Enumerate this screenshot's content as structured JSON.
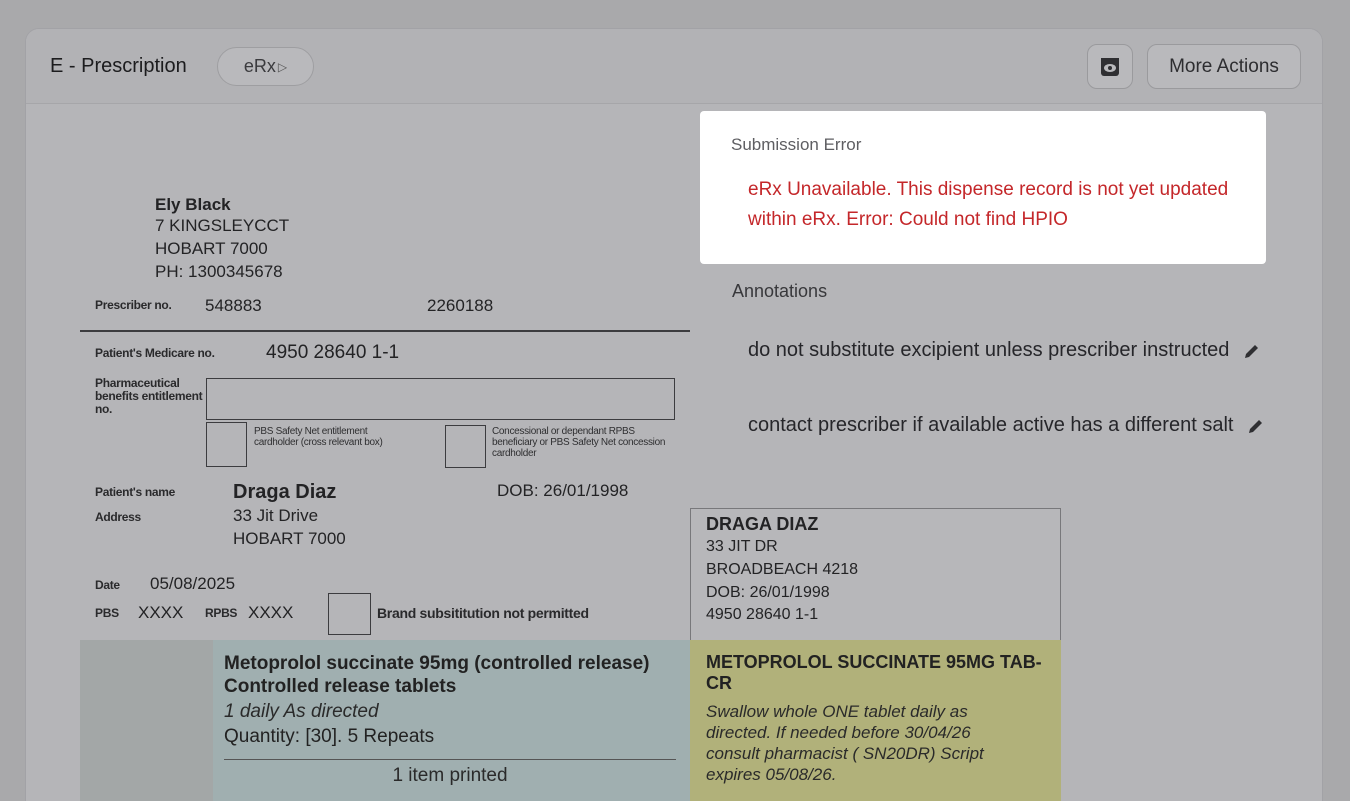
{
  "header": {
    "title": "E - Prescription",
    "badge": "eRx",
    "badge_icon": "arrow-icon",
    "preview_icon": "eye-icon",
    "more_actions": "More Actions"
  },
  "prescriber": {
    "name": "Ely Black",
    "address1": "7 KINGSLEYCCT",
    "address2": "HOBART 7000",
    "phone": "PH: 1300345678",
    "no_label": "Prescriber no.",
    "no": "548883",
    "no2": "2260188"
  },
  "patient": {
    "medicare_label": "Patient's Medicare no.",
    "medicare": "4950 28640 1-1",
    "pharm_label": "Pharmaceutical benefits entitlement no.",
    "pbs_safety": "PBS Safety Net entitlement cardholder (cross relevant box)",
    "concessional": "Concessional or dependant RPBS beneficiary or PBS Safety Net concession cardholder",
    "name_label": "Patient's name",
    "name": "Draga Diaz",
    "dob": "DOB: 26/01/1998",
    "address_label": "Address",
    "address1": "33 Jit Drive",
    "address2": "HOBART 7000"
  },
  "script": {
    "date_label": "Date",
    "date": "05/08/2025",
    "pbs_label": "PBS",
    "pbs": "XXXX",
    "rpbs_label": "RPBS",
    "rpbs": "XXXX",
    "brand_label": "Brand subsititution not permitted"
  },
  "dispense_label": {
    "name": "DRAGA DIAZ",
    "addr1": "33 JIT DR",
    "addr2": "BROADBEACH 4218",
    "dob": "DOB: 26/01/1998",
    "medicare": "4950 28640 1-1",
    "med_name": "METOPROLOL SUCCINATE 95MG TAB-CR",
    "directions": "Swallow whole ONE tablet daily as\ndirected. If needed before 30/04/26\nconsult pharmacist (  SN20DR)   Script\nexpires 05/08/26."
  },
  "medication": {
    "name": "Metoprolol succinate 95mg (controlled release) Controlled release tablets",
    "directions": "1 daily As directed",
    "quantity": "Quantity: [30]. 5 Repeats",
    "printed": "1 item printed"
  },
  "error": {
    "title": "Submission Error",
    "message": "eRx Unavailable. This dispense record is not yet updated within eRx. Error: Could not find HPIO"
  },
  "annotations": {
    "title": "Annotations",
    "items": [
      {
        "text": "do not substitute excipient unless prescriber instructed"
      },
      {
        "text": "contact prescriber if available active has a different salt"
      }
    ],
    "edit_icon": "pencil-icon"
  },
  "colors": {
    "error": "#c4272a",
    "overlay": "#a9a9ab"
  }
}
